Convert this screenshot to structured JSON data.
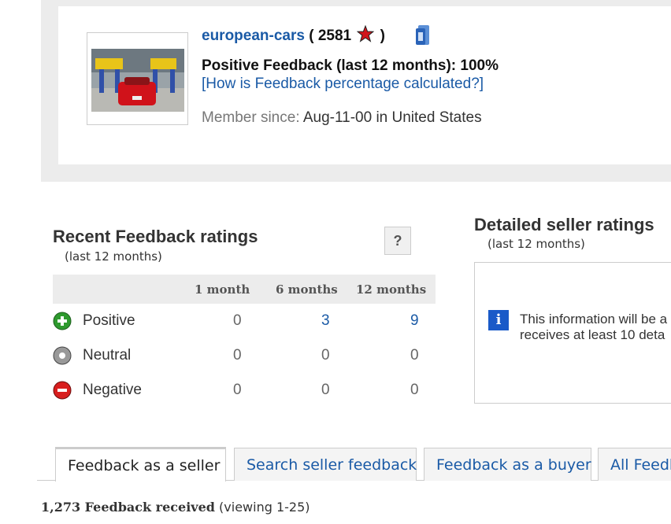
{
  "profile": {
    "username": "european-cars",
    "score_open": "( 2581",
    "score_close": ")",
    "positive_feedback": "Positive Feedback (last 12 months): 100%",
    "feedback_link": "[How is Feedback percentage calculated?]",
    "member_label": "Member since:",
    "member_value": "Aug-11-00 in United States",
    "star_color": "#d1141c"
  },
  "recent": {
    "title": "Recent Feedback ratings",
    "subtitle": "(last 12 months)",
    "help": "?",
    "columns": [
      "1 month",
      "6 months",
      "12 months"
    ],
    "rows": [
      {
        "label": "Positive",
        "values": [
          "0",
          "3",
          "9"
        ],
        "icon": "positive-icon"
      },
      {
        "label": "Neutral",
        "values": [
          "0",
          "0",
          "0"
        ],
        "icon": "neutral-icon"
      },
      {
        "label": "Negative",
        "values": [
          "0",
          "0",
          "0"
        ],
        "icon": "negative-icon"
      }
    ]
  },
  "detailed": {
    "title": "Detailed seller ratings",
    "subtitle": "(last 12 months)",
    "info_line1": "This information will be a",
    "info_line2": "receives at least 10 deta"
  },
  "tabs": [
    "Feedback as a seller",
    "Search seller feedback",
    "Feedback as a buyer",
    "All Feedb"
  ],
  "received": {
    "count": "1,273 Feedback received",
    "viewing": "(viewing 1-25)"
  }
}
